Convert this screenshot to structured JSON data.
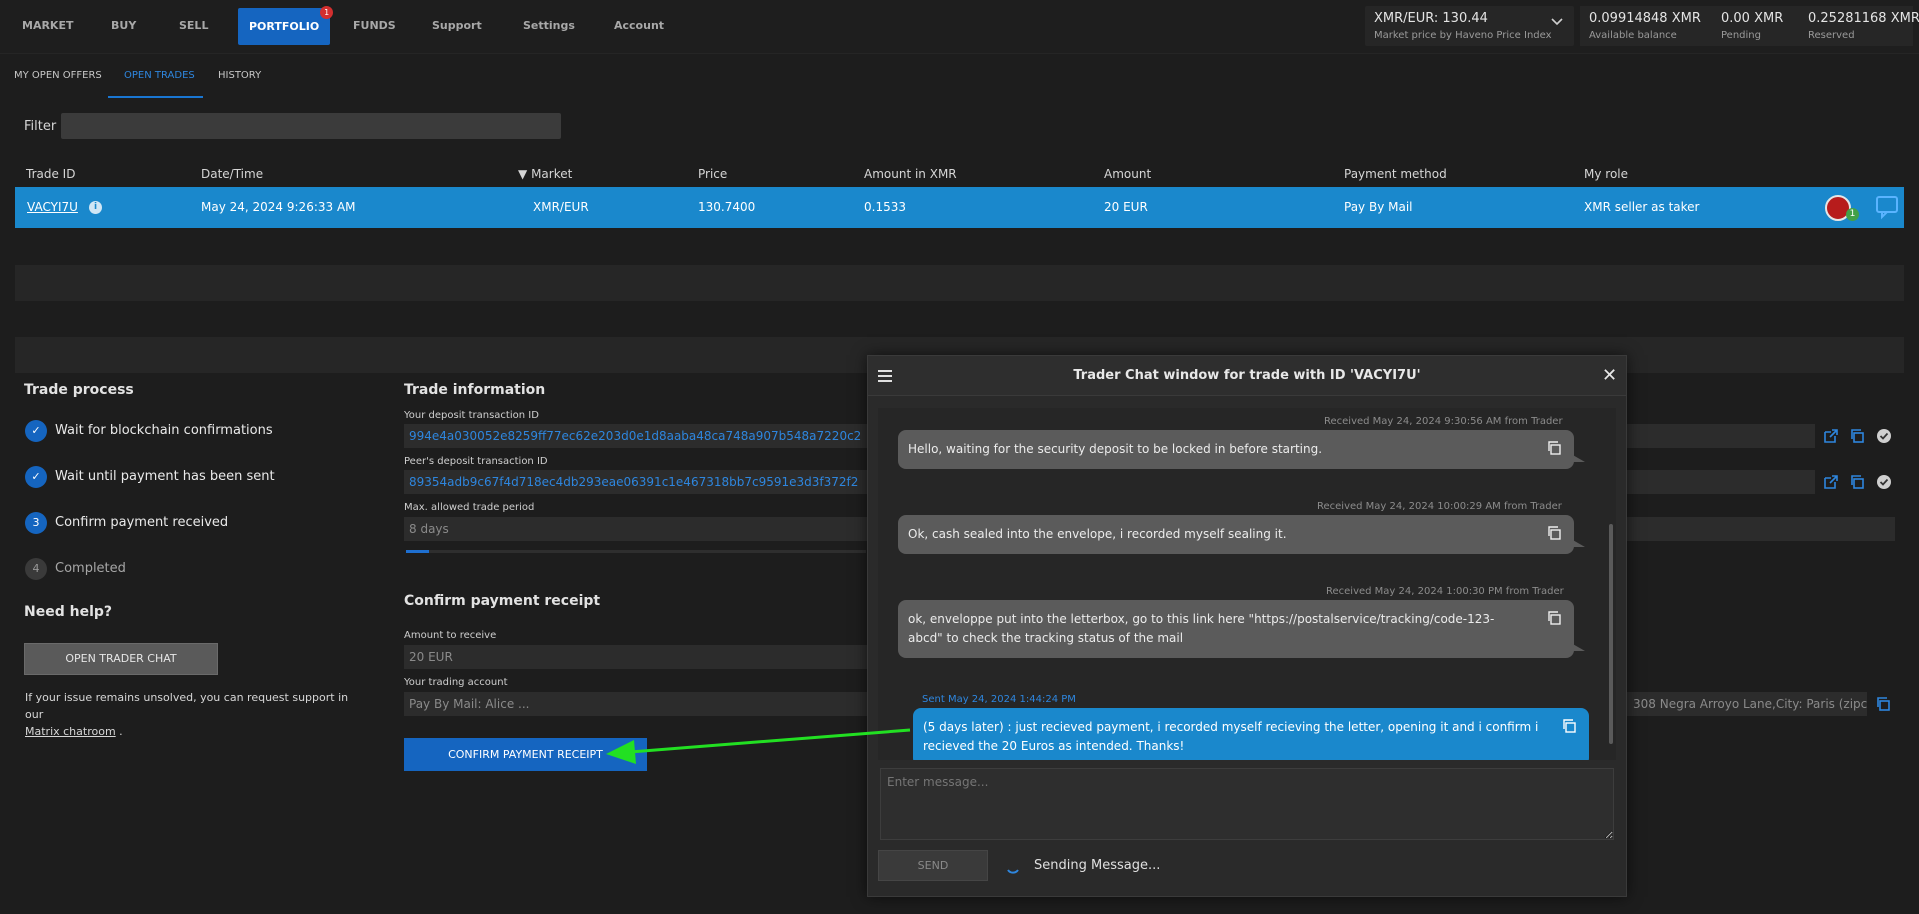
{
  "nav": {
    "items": [
      "MARKET",
      "BUY",
      "SELL",
      "PORTFOLIO",
      "FUNDS",
      "Support",
      "Settings",
      "Account"
    ],
    "active": "PORTFOLIO",
    "portfolio_badge": "1"
  },
  "market_price": {
    "value": "XMR/EUR: 130.44",
    "caption": "Market price by Haveno Price Index"
  },
  "balances": {
    "available": {
      "value": "0.09914848 XMR",
      "caption": "Available balance"
    },
    "pending": {
      "value": "0.00 XMR",
      "caption": "Pending"
    },
    "reserved": {
      "value": "0.25281168 XMR",
      "caption": "Reserved"
    }
  },
  "subtabs": {
    "open_offers": "MY OPEN OFFERS",
    "open_trades": "OPEN TRADES",
    "history": "HISTORY"
  },
  "filter": {
    "label": "Filter",
    "value": ""
  },
  "table": {
    "headers": {
      "trade_id": "Trade ID",
      "date": "Date/Time",
      "market": "Market",
      "price": "Price",
      "amount_xmr": "Amount in XMR",
      "amount": "Amount",
      "payment": "Payment method",
      "role": "My role"
    },
    "sort_indicator": "▼",
    "row": {
      "trade_id": "VACYI7U",
      "date": "May 24, 2024 9:26:33 AM",
      "market": "XMR/EUR",
      "price": "130.7400",
      "amount_xmr": "0.1533",
      "amount": "20 EUR",
      "payment": "Pay By Mail",
      "role": "XMR seller as taker",
      "peer_badge": "1"
    }
  },
  "trade_process": {
    "title": "Trade process",
    "steps": [
      {
        "num": "✓",
        "label": "Wait for blockchain confirmations"
      },
      {
        "num": "✓",
        "label": "Wait until payment has been sent"
      },
      {
        "num": "3",
        "label": "Confirm payment received"
      },
      {
        "num": "4",
        "label": "Completed"
      }
    ],
    "help_title": "Need help?",
    "open_chat_button": "OPEN TRADER CHAT",
    "help_text": "If your issue remains unsolved, you can request support in our",
    "help_link": "Matrix chatroom",
    "help_end": "."
  },
  "trade_info": {
    "title": "Trade information",
    "deposit_label": "Your deposit transaction ID",
    "deposit_value": "994e4a030052e8259ff77ec62e203d0e1d8aaba48ca748a907b548a7220c2",
    "peer_deposit_label": "Peer's deposit transaction ID",
    "peer_deposit_value": "89354adb9c67f4d718ec4db293eae06391c1e467318bb7c9591e3d3f372f2",
    "period_label": "Max. allowed trade period",
    "period_value": "8 days",
    "period_progress": 0.05
  },
  "confirm": {
    "title": "Confirm payment receipt",
    "amount_label": "Amount to receive",
    "amount_value": "20 EUR",
    "account_label": "Your trading account",
    "account_value": "Pay By Mail: Alice ...",
    "address_value": "308 Negra Arroyo Lane,City: Paris (zipc",
    "button": "CONFIRM PAYMENT RECEIPT"
  },
  "chat": {
    "title": "Trader Chat window for trade with ID 'VACYI7U'",
    "messages": [
      {
        "meta": "Received May 24, 2024 9:30:56 AM from Trader",
        "text": "Hello, waiting for the security deposit to be locked in before starting."
      },
      {
        "meta": "Received May 24, 2024 10:00:29 AM from Trader",
        "text": "Ok, cash sealed into the envelope, i recorded myself sealing it."
      },
      {
        "meta": "Received May 24, 2024 1:00:30 PM from Trader",
        "text": "ok, enveloppe put into the letterbox, go to this link here \"https://postalservice/tracking/code-123-abcd\" to check the tracking status of the mail"
      },
      {
        "meta": "Sent May 24, 2024 1:44:24 PM",
        "text": "(5 days later) : just recieved payment, i recorded myself recieving the letter, opening it and i confirm i recieved the 20 Euros as intended. Thanks!"
      }
    ],
    "input_placeholder": "Enter message...",
    "send_button": "SEND",
    "status": "Sending Message..."
  },
  "colors": {
    "accent": "#1565c0",
    "selected_row": "#1a88cc",
    "annotation_arrow": "#22e022"
  }
}
